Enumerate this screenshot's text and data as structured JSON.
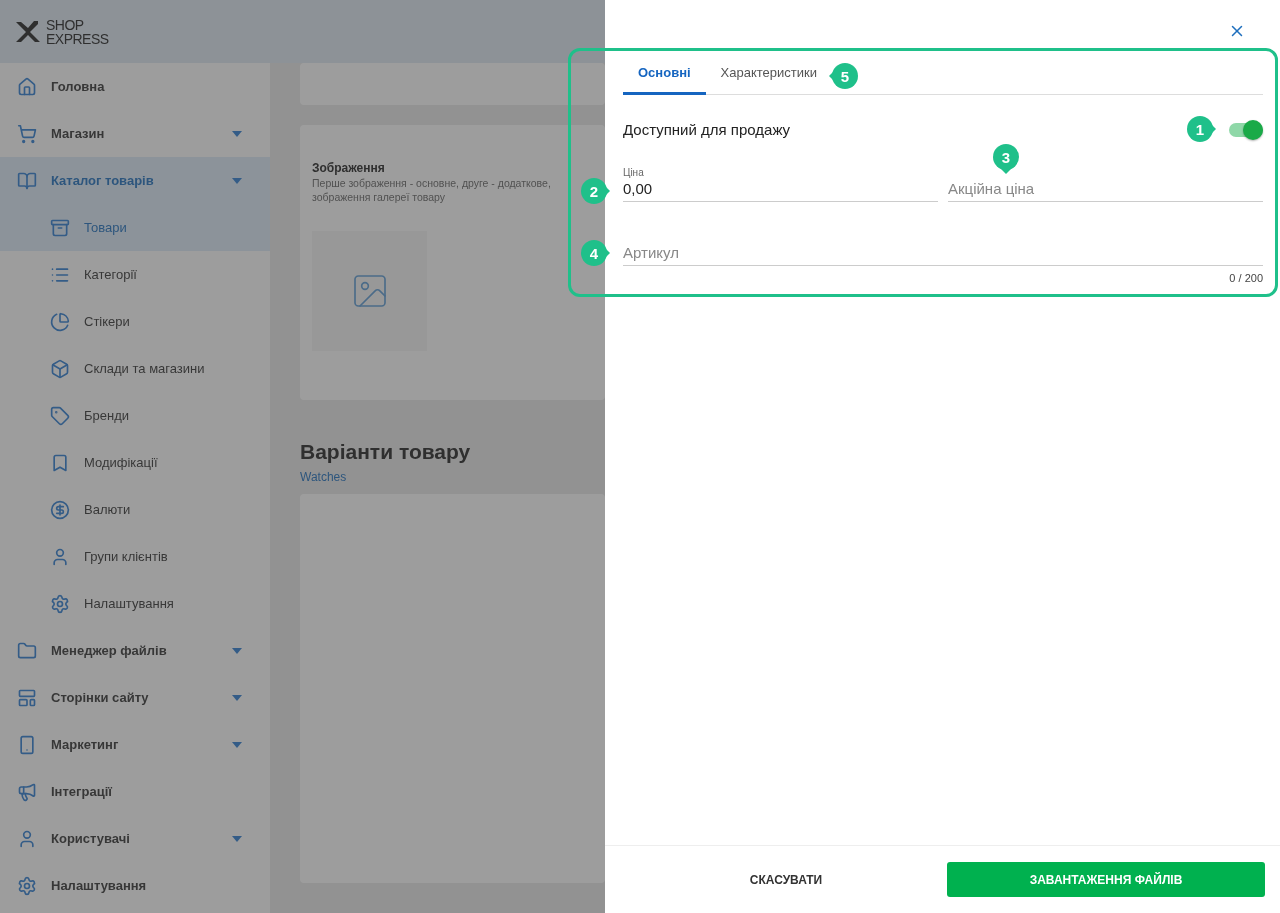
{
  "logo": {
    "line1": "SHOP",
    "line2": "EXPRESS"
  },
  "sidebar": {
    "items": [
      {
        "label": "Головна",
        "kind": "link",
        "selected": false
      },
      {
        "label": "Магазин",
        "kind": "group",
        "selected": false
      },
      {
        "label": "Каталог товарів",
        "kind": "group",
        "selected": true,
        "children": [
          {
            "label": "Товари",
            "selected": true
          },
          {
            "label": "Категорії",
            "selected": false
          },
          {
            "label": "Стікери",
            "selected": false
          },
          {
            "label": "Склади та магазини",
            "selected": false
          },
          {
            "label": "Бренди",
            "selected": false
          },
          {
            "label": "Модифікації",
            "selected": false
          },
          {
            "label": "Валюти",
            "selected": false
          },
          {
            "label": "Групи клієнтів",
            "selected": false
          },
          {
            "label": "Налаштування",
            "selected": false
          }
        ]
      },
      {
        "label": "Менеджер файлів",
        "kind": "group",
        "selected": false
      },
      {
        "label": "Сторінки сайту",
        "kind": "group",
        "selected": false
      },
      {
        "label": "Маркетинг",
        "kind": "group",
        "selected": false
      },
      {
        "label": "Інтеграції",
        "kind": "link",
        "selected": false
      },
      {
        "label": "Користувачі",
        "kind": "group",
        "selected": false
      },
      {
        "label": "Налаштування",
        "kind": "link",
        "selected": false
      }
    ]
  },
  "main": {
    "images_title": "Зображення",
    "images_text_1": "Перше зображення - основне, друге - додаткове,",
    "images_text_2": "зображення галереї товару",
    "variants_title": "Варіанти товару",
    "variants_link": "Watches"
  },
  "drawer": {
    "tabs": [
      {
        "label": "Основні",
        "selected": true
      },
      {
        "label": "Характеристики",
        "selected": false,
        "callout": "5"
      }
    ],
    "available": {
      "label": "Доступний для продажу",
      "on": true,
      "callout": "1"
    },
    "price": {
      "label": "Ціна",
      "value": "0,00",
      "callout": "2"
    },
    "sale_price": {
      "placeholder": "Акційна ціна",
      "callout": "3"
    },
    "sku": {
      "placeholder": "Артикул",
      "counter": "0 / 200",
      "callout": "4"
    },
    "cancel": "СКАСУВАТИ",
    "submit": "ЗАВАНТАЖЕННЯ ФАЙЛІВ"
  }
}
